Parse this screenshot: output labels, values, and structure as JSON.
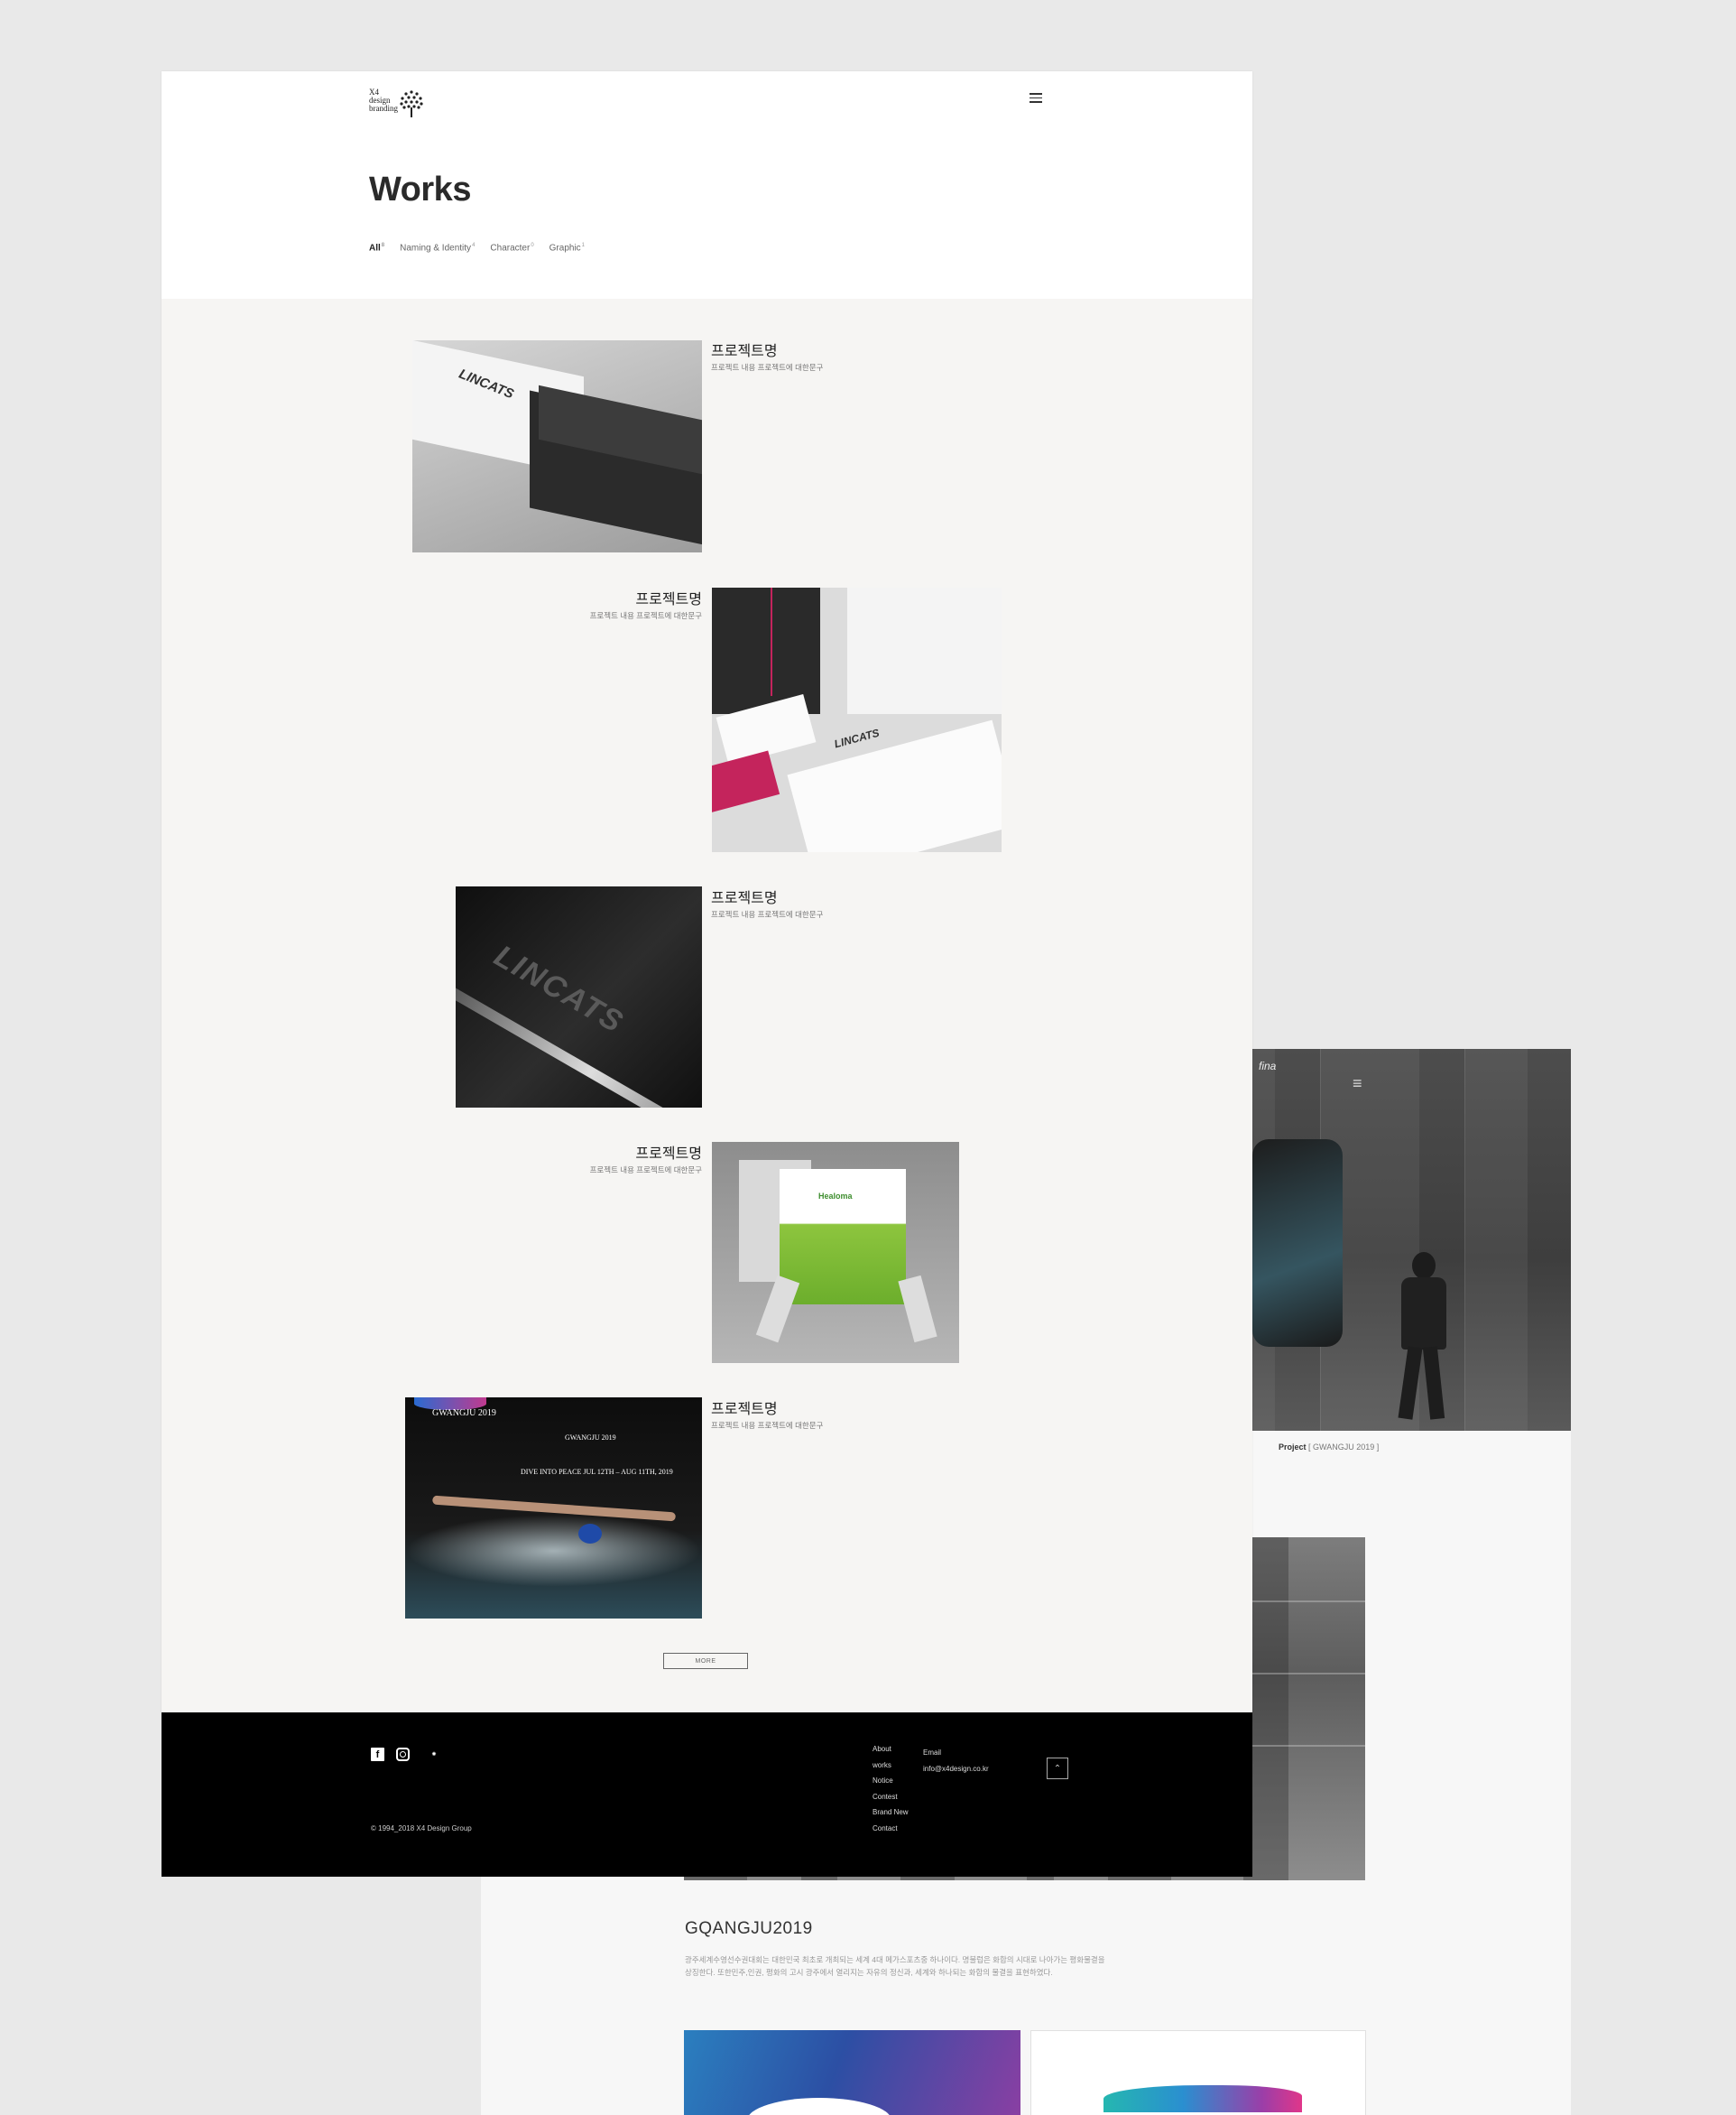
{
  "front": {
    "logo": {
      "line1": "X4",
      "line2": "design",
      "line3": "branding"
    },
    "title": "Works",
    "filters": [
      {
        "label": "All",
        "count": "8"
      },
      {
        "label": "Naming & Identity",
        "count": "4"
      },
      {
        "label": "Character",
        "count": "0"
      },
      {
        "label": "Graphic",
        "count": "1"
      }
    ],
    "items": [
      {
        "title": "프로젝트명",
        "subtitle": "프로젝트 내용 프로젝트에 대한문구",
        "image_brand": "LINCATS"
      },
      {
        "title": "프로젝트명",
        "subtitle": "프로젝트 내용 프로젝트에 대한문구",
        "image_brand": "LINCATS"
      },
      {
        "title": "프로젝트명",
        "subtitle": "프로젝트 내용 프로젝트에 대한문구",
        "image_brand": "LINCATS"
      },
      {
        "title": "프로젝트명",
        "subtitle": "프로젝트 내용 프로젝트에 대한문구",
        "image_brand": "Healoma"
      },
      {
        "title": "프로젝트명",
        "subtitle": "프로젝트 내용 프로젝트에 대한문구",
        "image_brand": "GWANGJU 2019",
        "image_tag": "DIVE INTO PEACE   JUL 12TH – AUG 11TH, 2019"
      }
    ],
    "more_label": "MORE",
    "footer": {
      "nav": [
        "About",
        "works",
        "Notice",
        "Contest",
        "Brand New",
        "Contact"
      ],
      "email_label": "Email",
      "email": "info@x4design.co.kr",
      "copyright": "© 1994_2018 X4 Design Group",
      "top_icon": "chevron-up-icon",
      "social": [
        "facebook-icon",
        "instagram-icon",
        "x4-logo-icon"
      ]
    }
  },
  "back": {
    "hero_brand": "fina",
    "caption_label": "Project",
    "caption_value": "[ GWANGJU 2019 ]",
    "title": "GQANGJU2019",
    "description": "광주세계수영선수권대회는 대한민국 최초로 개최되는 세계 4대 메가스포츠중 하나이다. 명불럽은 화합의 시대로 나아가는 평화물결을 상징한다. 또한민주,인권, 평화의 고시 광주에서 열리지는 자유의 정신과, 세계와 하나되는 화합의 물결을 표현하였다."
  },
  "colors": {
    "accent_red": "#c4245c",
    "footer_bg": "#000000",
    "page_bg": "#e9e9e9"
  }
}
